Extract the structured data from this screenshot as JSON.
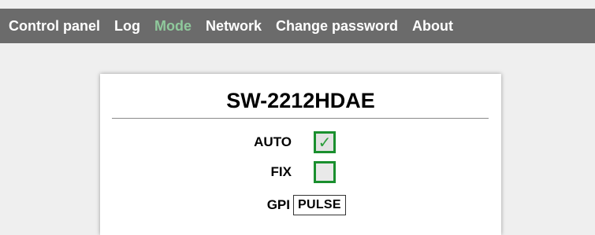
{
  "nav": {
    "items": [
      {
        "label": "Control panel"
      },
      {
        "label": "Log"
      },
      {
        "label": "Mode"
      },
      {
        "label": "Network"
      },
      {
        "label": "Change password"
      },
      {
        "label": "About"
      }
    ],
    "active_index": 2,
    "active_color": "#8fc99c"
  },
  "panel": {
    "device_name": "SW-2212HDAE",
    "modes": {
      "auto": {
        "label": "AUTO",
        "checked": true,
        "check_icon": "check-mark-icon"
      },
      "fix": {
        "label": "FIX",
        "checked": false
      }
    },
    "gpi": {
      "label": "GPI",
      "value": "PULSE"
    }
  },
  "colors": {
    "navbar": "#6b6b6b",
    "checkbox_border": "#1a8f2e",
    "check_mark": "#2a9d3a"
  }
}
